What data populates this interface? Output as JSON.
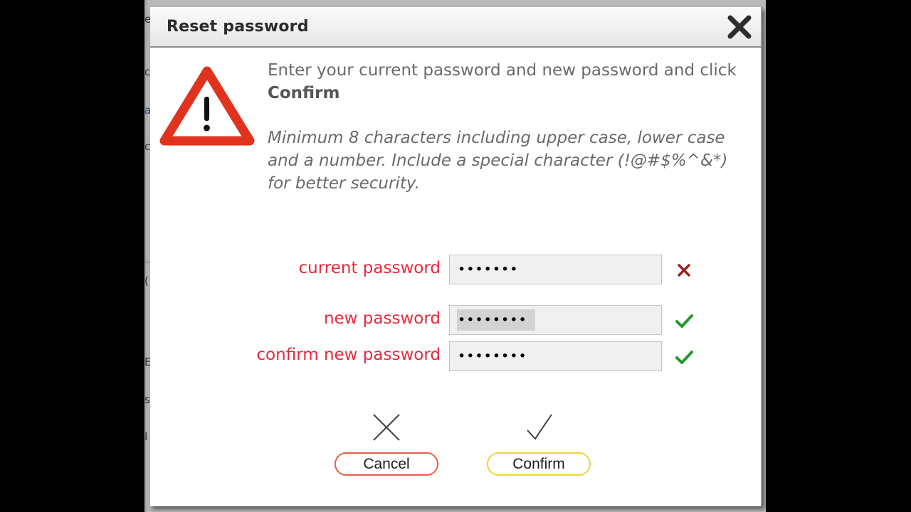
{
  "dialog": {
    "title": "Reset password",
    "close_icon": "close-icon",
    "warning_icon": "warning-triangle-icon",
    "intro_text": "Enter your current password and new password and click ",
    "intro_bold": "Confirm",
    "hint_text": "Minimum 8 characters including upper case, lower case and a number. Include a special character (!@#$%^&*) for better security."
  },
  "fields": [
    {
      "label": "current password",
      "value": "•••••••",
      "status": "invalid",
      "status_icon": "cross-icon",
      "status_color": "#a01c1c",
      "selected": false
    },
    {
      "label": "new password",
      "value": "••••••••",
      "status": "valid",
      "status_icon": "check-icon",
      "status_color": "#1f9a2e",
      "selected": true
    },
    {
      "label": "confirm new password",
      "value": "••••••••",
      "status": "valid",
      "status_icon": "check-icon",
      "status_color": "#1f9a2e",
      "selected": false
    }
  ],
  "actions": {
    "cancel": {
      "label": "Cancel",
      "icon": "x-icon",
      "border_color": "#ef5a47"
    },
    "confirm": {
      "label": "Confirm",
      "icon": "check-icon",
      "border_color": "#f2d43a"
    }
  },
  "colors": {
    "label": "#e8293b",
    "warning": "#e0321c",
    "text": "#6a6a6a"
  }
}
